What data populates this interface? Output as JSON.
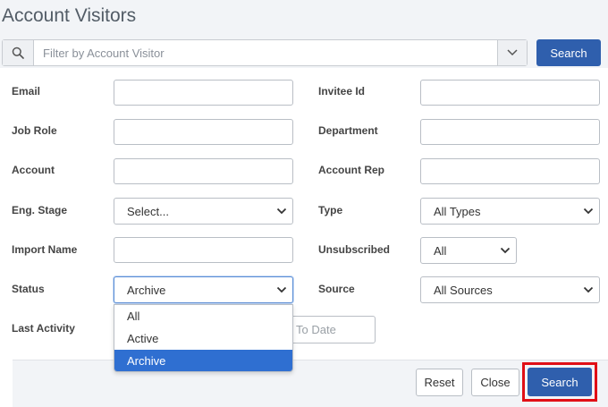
{
  "page": {
    "title": "Account Visitors"
  },
  "filter": {
    "placeholder": "Filter by Account Visitor",
    "search_label": "Search"
  },
  "form": {
    "left": [
      {
        "label": "Email"
      },
      {
        "label": "Job Role"
      },
      {
        "label": "Account"
      },
      {
        "label": "Eng. Stage",
        "value": "Select..."
      },
      {
        "label": "Import Name"
      },
      {
        "label": "Status",
        "value": "Archive"
      },
      {
        "label": "Last Activity"
      }
    ],
    "right": [
      {
        "label": "Invitee Id"
      },
      {
        "label": "Department"
      },
      {
        "label": "Account Rep"
      },
      {
        "label": "Type",
        "value": "All Types"
      },
      {
        "label": "Unsubscribed",
        "value": "All"
      },
      {
        "label": "Source",
        "value": "All Sources"
      }
    ],
    "to_date_placeholder": "To Date"
  },
  "status_dropdown": {
    "options": [
      "All",
      "Active",
      "Archive"
    ],
    "selected": "Archive"
  },
  "footer": {
    "reset_label": "Reset",
    "close_label": "Close",
    "search_label": "Search"
  },
  "colors": {
    "primary": "#2f5fad",
    "highlight": "#e10f16",
    "selected_option": "#2f6fd1"
  }
}
